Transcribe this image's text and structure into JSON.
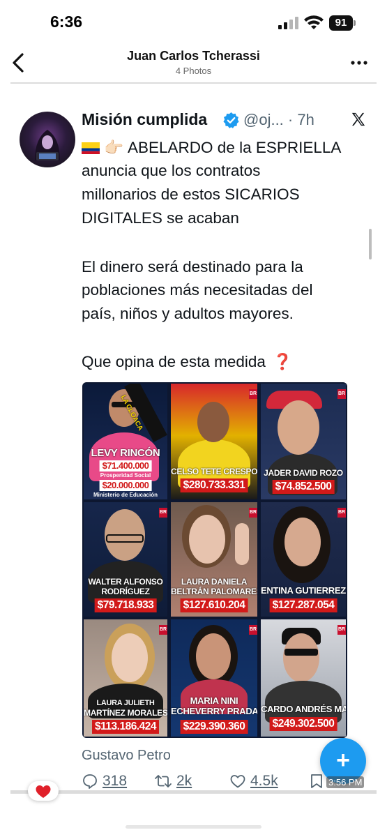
{
  "status_bar": {
    "time": "6:36",
    "battery": "91"
  },
  "photos_header": {
    "title": "Juan Carlos Tcherassi",
    "subtitle": "4 Photos"
  },
  "tweet": {
    "author_name": "Misión cumplida",
    "handle": "@oj...",
    "time_ago": "· 7h",
    "lines": [
      "ABELARDO de la ESPRIELLA",
      "anuncia que los contratos",
      "millonarios de estos SICARIOS",
      "DIGITALES se acaban",
      "El dinero será destinado para la",
      "poblaciones más necesitadas del",
      "país, niños y adultos mayores.",
      "Que opina de esta medida"
    ],
    "question_mark": "❓",
    "pointing_emoji": "👉🏻",
    "reply_author": "Gustavo Petro",
    "actions": {
      "replies": "318",
      "retweets": "2k",
      "likes": "4.5k"
    }
  },
  "media_grid": [
    {
      "name": "LEVY RINCÓN",
      "amount_1": "$71.400.000",
      "caption_1": "Prosperidad Social",
      "amount_2": "$20.000.000",
      "caption_2": "Ministerio de Educación",
      "banner": "LA CLOACA"
    },
    {
      "name": "CELSO TETE CRESPO",
      "amount": "$280.733.331"
    },
    {
      "name": "JADER DAVID ROZO",
      "amount": "$74.852.500"
    },
    {
      "name_line1": "WALTER ALFONSO",
      "name_line2": "RODRÍGUEZ",
      "amount": "$79.718.933"
    },
    {
      "name_line1": "LAURA DANIELA",
      "name_line2": "BELTRÁN PALOMARES",
      "amount": "$127.610.204"
    },
    {
      "name": "ENTINA GUTIERREZ AR",
      "amount": "$127.287.054"
    },
    {
      "name_line1": "LAURA JULIETH",
      "name_line2": "MARTÍNEZ MORALES",
      "amount": "$113.186.424"
    },
    {
      "name_line1": "MARIA NINI",
      "name_line2": "ECHEVERRY PRADA",
      "amount": "$229.390.360"
    },
    {
      "name": "CARDO ANDRÉS MALAG",
      "amount": "$249.302.500"
    }
  ],
  "fab_label": "+",
  "screenshot_timestamp": "3:56 PM",
  "colors": {
    "accent": "#1d9bf0",
    "price_red": "#d21a1a",
    "text_gray": "#536471",
    "like_heart": "#e0202a"
  }
}
